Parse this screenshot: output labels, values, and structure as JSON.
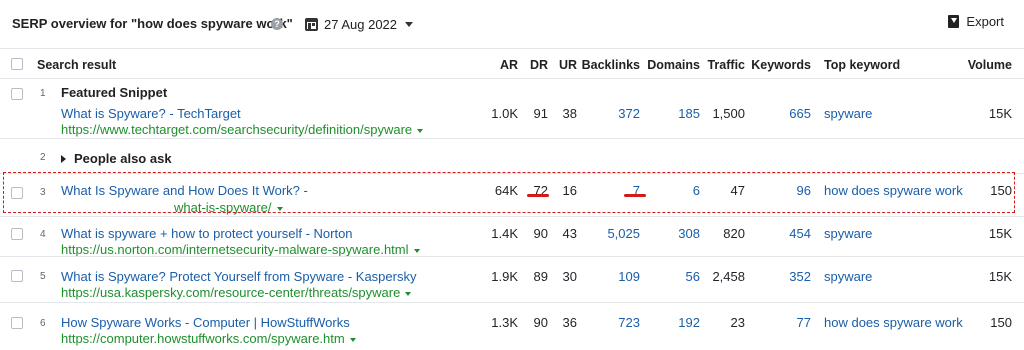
{
  "header": {
    "title": "SERP overview for \"how does spyware work\"",
    "help_glyph": "?",
    "date": "27 Aug 2022",
    "export_label": "Export"
  },
  "columns": {
    "search_result": "Search result",
    "ar": "AR",
    "dr": "DR",
    "ur": "UR",
    "backlinks": "Backlinks",
    "domains": "Domains",
    "traffic": "Traffic",
    "keywords": "Keywords",
    "top_keyword": "Top keyword",
    "volume": "Volume"
  },
  "rows": [
    {
      "pos": "1",
      "label": "Featured Snippet",
      "title": "What is Spyware? - TechTarget",
      "url": "https://www.techtarget.com/searchsecurity/definition/spyware",
      "ar": "1.0K",
      "dr": "91",
      "ur": "38",
      "backlinks": "372",
      "domains": "185",
      "traffic": "1,500",
      "keywords": "665",
      "top_keyword": "spyware",
      "volume": "15K"
    },
    {
      "pos": "2",
      "label": "People also ask"
    },
    {
      "pos": "3",
      "title": "What Is Spyware and How Does It Work? -",
      "url": "what-is-spyware/",
      "ar": "64K",
      "dr": "72",
      "ur": "16",
      "backlinks": "7",
      "domains": "6",
      "traffic": "47",
      "keywords": "96",
      "top_keyword": "how does spyware work",
      "volume": "150"
    },
    {
      "pos": "4",
      "title": "What is spyware + how to protect yourself - Norton",
      "url": "https://us.norton.com/internetsecurity-malware-spyware.html",
      "ar": "1.4K",
      "dr": "90",
      "ur": "43",
      "backlinks": "5,025",
      "domains": "308",
      "traffic": "820",
      "keywords": "454",
      "top_keyword": "spyware",
      "volume": "15K"
    },
    {
      "pos": "5",
      "title": "What is Spyware? Protect Yourself from Spyware - Kaspersky",
      "url": "https://usa.kaspersky.com/resource-center/threats/spyware",
      "ar": "1.9K",
      "dr": "89",
      "ur": "30",
      "backlinks": "109",
      "domains": "56",
      "traffic": "2,458",
      "keywords": "352",
      "top_keyword": "spyware",
      "volume": "15K"
    },
    {
      "pos": "6",
      "title": "How Spyware Works - Computer | HowStuffWorks",
      "url": "https://computer.howstuffworks.com/spyware.htm",
      "ar": "1.3K",
      "dr": "90",
      "ur": "36",
      "backlinks": "723",
      "domains": "192",
      "traffic": "23",
      "keywords": "77",
      "top_keyword": "how does spyware work",
      "volume": "150"
    }
  ],
  "colors": {
    "link": "#1a5ea8",
    "url": "#1f8f2d",
    "highlight": "#d11a1a"
  },
  "icons": [
    "help-icon",
    "calendar-icon",
    "chevron-down-icon",
    "export-icon",
    "expand-triangle-icon"
  ]
}
